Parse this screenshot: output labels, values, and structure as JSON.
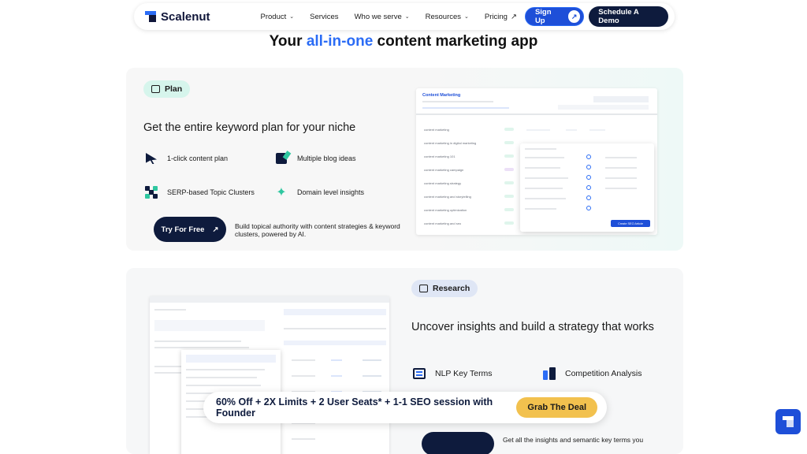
{
  "nav": {
    "brand": "Scalenut",
    "items": [
      {
        "label": "Product",
        "chevron": true
      },
      {
        "label": "Services",
        "chevron": false
      },
      {
        "label": "Who we serve",
        "chevron": true
      },
      {
        "label": "Resources",
        "chevron": true
      },
      {
        "label": "Pricing",
        "chevron": false,
        "external": true
      }
    ],
    "signup_label": "Sign Up",
    "demo_label": "Schedule A Demo",
    "chevron_glyph": "⌄",
    "arrow_glyph": "↗"
  },
  "headline": {
    "prefix": "Your ",
    "accent": "all-in-one",
    "suffix": " content marketing app",
    "accent_color": "#2b6cf5"
  },
  "plan_card": {
    "tag": "Plan",
    "title": "Get the entire keyword plan for your niche",
    "features": [
      {
        "icon": "cursor-click-icon",
        "label": "1-click content plan"
      },
      {
        "icon": "blog-note-icon",
        "label": "Multiple blog ideas"
      },
      {
        "icon": "cluster-icon",
        "label": "SERP-based Topic Clusters"
      },
      {
        "icon": "star-insight-icon",
        "label": "Domain level insights"
      }
    ],
    "cta_label": "Try For Free",
    "cta_description": "Build topical authority with content strategies & keyword clusters, powered by AI.",
    "mock": {
      "title": "Content Marketing",
      "rows": [
        "content marketing",
        "content marketing in digital marketing",
        "content marketing 101",
        "content marketing campaign",
        "content marketing strategy",
        "content marketing and storytelling",
        "content marketing optimization",
        "content marketing and seo"
      ],
      "button": "Create SEO Article"
    }
  },
  "research_card": {
    "tag": "Research",
    "title": "Uncover insights and build a strategy that works",
    "features": [
      {
        "icon": "nlp-terms-icon",
        "label": "NLP Key Terms"
      },
      {
        "icon": "competition-analysis-icon",
        "label": "Competition Analysis"
      }
    ],
    "peek_text": "Get all the insights and semantic key terms you"
  },
  "promo": {
    "text": "60% Off + 2X Limits + 2 User Seats* + 1-1 SEO session with Founder",
    "button": "Grab The Deal",
    "button_color": "#f2c14e"
  },
  "colors": {
    "brand_navy": "#0e1b3d",
    "brand_blue": "#1e4fd8",
    "plan_tag": "#d6f5ec",
    "research_tag": "#dfe6f5"
  }
}
